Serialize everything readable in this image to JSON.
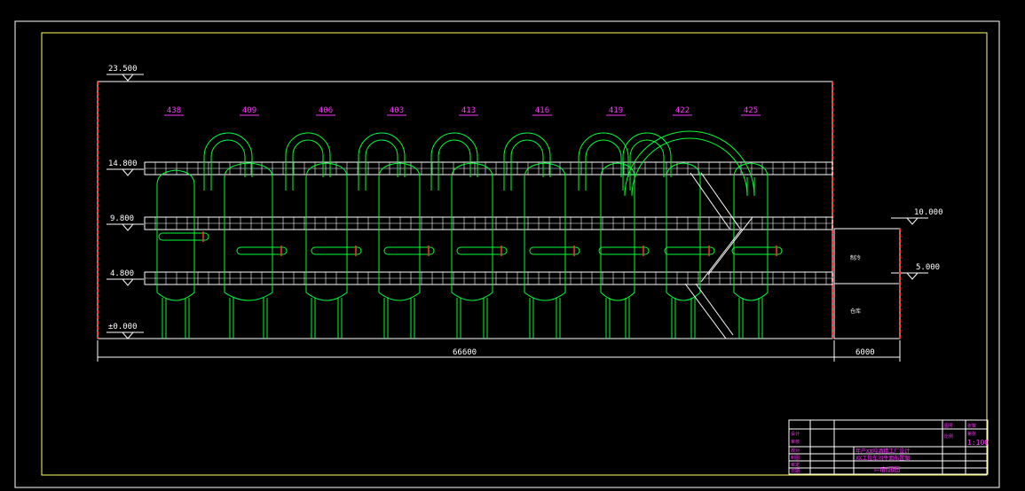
{
  "colors": {
    "background": "#000000",
    "border": "#ffffff",
    "frame": "#ffff66",
    "equipment": "#00ff33",
    "label": "#ff33ff",
    "column": "#ff3333",
    "dimension": "#ffffff"
  },
  "elevations": {
    "top": "23.500",
    "l1": "14.800",
    "l2": "9.800",
    "l3": "4.800",
    "ground": "±0.000",
    "annex_top": "10.000",
    "annex_mid": "5.000"
  },
  "equipment_labels": [
    "438",
    "409",
    "406",
    "403",
    "413",
    "416",
    "419",
    "422",
    "425"
  ],
  "dimensions": {
    "main_width": "66600",
    "annex_width": "6000"
  },
  "annex_rooms": {
    "upper": "制冷",
    "lower": "仓库"
  },
  "title_block": {
    "scale": "1:100",
    "project_line1": "年产XX吨酒精工厂设计",
    "project_line2": "XX工段车间平面布置图",
    "drawing_name": "Ⅰ—Ⅰ剖面图",
    "row_labels": [
      "设计",
      "审核",
      "校对",
      "制图",
      "审定",
      "日期"
    ],
    "right_labels": [
      "图号",
      "比例"
    ],
    "right_cells": [
      "张数",
      "第张"
    ]
  }
}
